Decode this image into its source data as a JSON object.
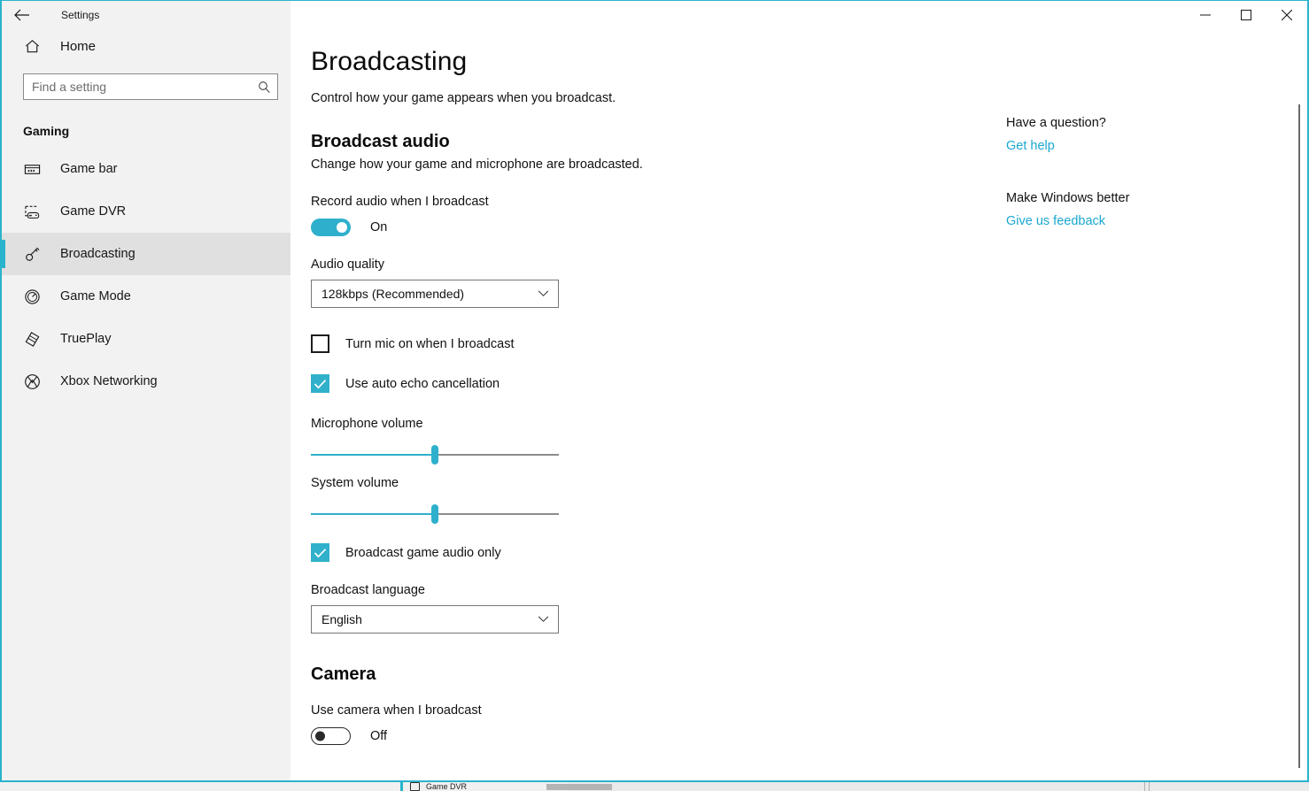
{
  "window": {
    "title": "Settings",
    "back_icon": "back-arrow-icon",
    "minimize_icon": "minimize-icon",
    "maximize_icon": "maximize-icon",
    "close_icon": "close-icon",
    "accent_color": "#29b3cc"
  },
  "sidebar": {
    "home": {
      "label": "Home",
      "icon": "home-icon"
    },
    "search": {
      "placeholder": "Find a setting",
      "value": "",
      "icon": "search-icon"
    },
    "category": "Gaming",
    "items": [
      {
        "label": "Game bar",
        "icon": "game-bar-icon",
        "selected": false
      },
      {
        "label": "Game DVR",
        "icon": "game-dvr-icon",
        "selected": false
      },
      {
        "label": "Broadcasting",
        "icon": "broadcasting-icon",
        "selected": true
      },
      {
        "label": "Game Mode",
        "icon": "game-mode-icon",
        "selected": false
      },
      {
        "label": "TruePlay",
        "icon": "trueplay-icon",
        "selected": false
      },
      {
        "label": "Xbox Networking",
        "icon": "xbox-icon",
        "selected": false
      }
    ]
  },
  "main": {
    "title": "Broadcasting",
    "subtitle": "Control how your game appears when you broadcast.",
    "sections": [
      {
        "heading": "Broadcast audio",
        "description": "Change how your game and microphone are broadcasted."
      },
      {
        "heading": "Camera",
        "description": ""
      }
    ],
    "record_audio": {
      "label": "Record audio when I broadcast",
      "state": "On",
      "on": true
    },
    "audio_quality": {
      "label": "Audio quality",
      "value": "128kbps (Recommended)",
      "caret_icon": "chevron-down-icon"
    },
    "turn_mic_on": {
      "label": "Turn mic on when I broadcast",
      "checked": false
    },
    "echo_cancellation": {
      "label": "Use auto echo cancellation",
      "checked": true
    },
    "microphone_volume": {
      "label": "Microphone volume",
      "value": 50
    },
    "system_volume": {
      "label": "System volume",
      "value": 50
    },
    "game_audio_only": {
      "label": "Broadcast game audio only",
      "checked": true
    },
    "broadcast_language": {
      "label": "Broadcast language",
      "value": "English",
      "caret_icon": "chevron-down-icon"
    },
    "use_camera": {
      "label": "Use camera when I broadcast",
      "state": "Off",
      "on": false
    }
  },
  "help": {
    "question_title": "Have a question?",
    "question_link": "Get help",
    "feedback_title": "Make Windows better",
    "feedback_link": "Give us feedback",
    "link_color": "#1aa8cf"
  },
  "background_window": {
    "item_label": "Game DVR",
    "item_icon": "game-dvr-icon"
  }
}
